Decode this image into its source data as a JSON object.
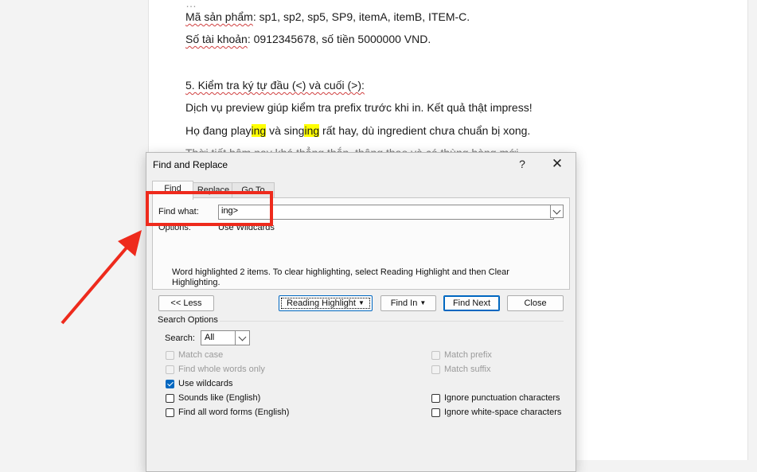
{
  "document": {
    "line_top": "…",
    "line1": {
      "product_label": "Mã sản phẩm",
      "product_rest": ": sp1, sp2, sp5, SP9, itemA, itemB, ITEM-C."
    },
    "line2": {
      "account_label": "Số tài khoản",
      "account_rest": ": 0912345678, số tiền 5000000 VND."
    },
    "line3": {
      "heading": "5. Kiểm tra ký tự đầu (<) và cuối (>):"
    },
    "line4": {
      "text": "Dịch vụ preview giúp kiểm tra prefix trước khi in. Kết quả thật impress!"
    },
    "line5": {
      "part1": "Họ đang play",
      "hl1": "ing",
      "part2": " và sing",
      "hl2": "ing",
      "part3": " rất hay, dù ingredient chưa chuẩn bị xong."
    },
    "line6": {
      "text": "Thời tiết hôm nay khá thẳng thắn, thông thạo và có thùng hàng mới."
    }
  },
  "dialog": {
    "title": "Find and Replace",
    "help": "?",
    "close": "✕",
    "tabs": [
      "Find",
      "Replace",
      "Go To"
    ],
    "find_what_label": "Find what:",
    "find_what_value": "ing>",
    "options_label": "Options:",
    "options_value": "Use Wildcards",
    "message": "Word highlighted 2 items. To clear highlighting, select Reading Highlight and then Clear Highlighting.",
    "buttons": {
      "less": "<< Less",
      "reading_highlight": "Reading Highlight",
      "find_in": "Find In",
      "find_next": "Find Next",
      "close": "Close"
    },
    "search_options": {
      "title": "Search Options",
      "search_label": "Search:",
      "search_value": "All",
      "left": [
        {
          "label": "Match case",
          "checked": false,
          "enabled": false
        },
        {
          "label": "Find whole words only",
          "checked": false,
          "enabled": false
        },
        {
          "label": "Use wildcards",
          "checked": true,
          "enabled": true
        },
        {
          "label": "Sounds like (English)",
          "checked": false,
          "enabled": true
        },
        {
          "label": "Find all word forms (English)",
          "checked": false,
          "enabled": true
        }
      ],
      "right": [
        {
          "label": "Match prefix",
          "checked": false,
          "enabled": false
        },
        {
          "label": "Match suffix",
          "checked": false,
          "enabled": false
        },
        {
          "label": "Ignore punctuation characters",
          "checked": false,
          "enabled": true
        },
        {
          "label": "Ignore white-space characters",
          "checked": false,
          "enabled": true
        }
      ]
    }
  },
  "annotation": {
    "color": "#ee2a1c"
  },
  "colors": {
    "accent": "#0067c0",
    "highlight": "#ffff00"
  }
}
